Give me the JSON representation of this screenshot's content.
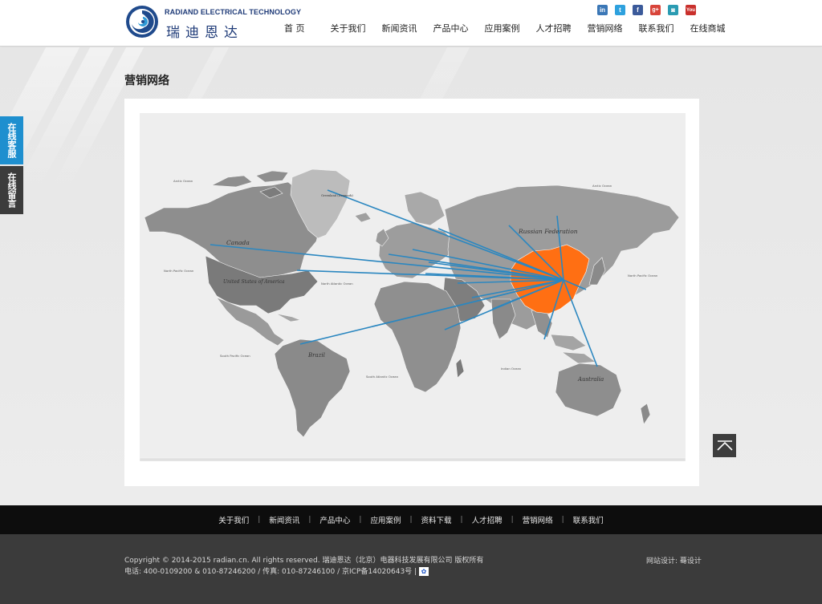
{
  "logo": {
    "en": "RADIAND ELECTRICAL TECHNOLOGY",
    "cn": "瑞迪恩达"
  },
  "nav": [
    "首 页",
    "关于我们",
    "新闻资讯",
    "产品中心",
    "应用案例",
    "人才招聘",
    "营销网络",
    "联系我们",
    "在线商城"
  ],
  "social": [
    {
      "icon": "linkedin-icon",
      "glyph": "in",
      "color": "#3b77b6"
    },
    {
      "icon": "twitter-icon",
      "glyph": "t",
      "color": "#2ea1de"
    },
    {
      "icon": "facebook-icon",
      "glyph": "f",
      "color": "#3b5a9a"
    },
    {
      "icon": "google-plus-icon",
      "glyph": "g+",
      "color": "#d8443a"
    },
    {
      "icon": "instagram-icon",
      "glyph": "◙",
      "color": "#2a9bb2"
    },
    {
      "icon": "youtube-icon",
      "glyph": "You",
      "color": "#c9302c"
    }
  ],
  "page_title": "营销网络",
  "side": {
    "service": "在线客服",
    "message": "在线留言"
  },
  "map": {
    "labels": {
      "russia": "Russian Federation",
      "canada": "Canada",
      "usa": "United States of America",
      "brazil": "Brazil",
      "australia": "Australia",
      "greenland": "Greenland (Denmark)",
      "arctic": "Arctic Ocean",
      "arctic_right": "Arctic Ocean",
      "north_pacific": "North Pacific Ocean",
      "north_pacific_right": "North Pacific Ocean",
      "north_atlantic": "North Atlantic Ocean",
      "south_pacific": "South Pacific Ocean",
      "south_atlantic": "South Atlantic Ocean",
      "indian": "Indian Ocean"
    },
    "highlight_color": "#ff6f13",
    "line_color": "#2b87c0"
  },
  "footer_nav": [
    "关于我们",
    "新闻资讯",
    "产品中心",
    "应用案例",
    "资料下载",
    "人才招聘",
    "营销网络",
    "联系我们"
  ],
  "footer": {
    "line1": "Copyright © 2014-2015 radian.cn. All rights reserved. 瑞迪恩达（北京）电器科技发展有限公司 版权所有",
    "line2": "电话: 400-0109200 & 010-87246200  /  传真: 010-87246100  /  京ICP备14020643号 |",
    "design": "网站设计: 蓦设计"
  }
}
